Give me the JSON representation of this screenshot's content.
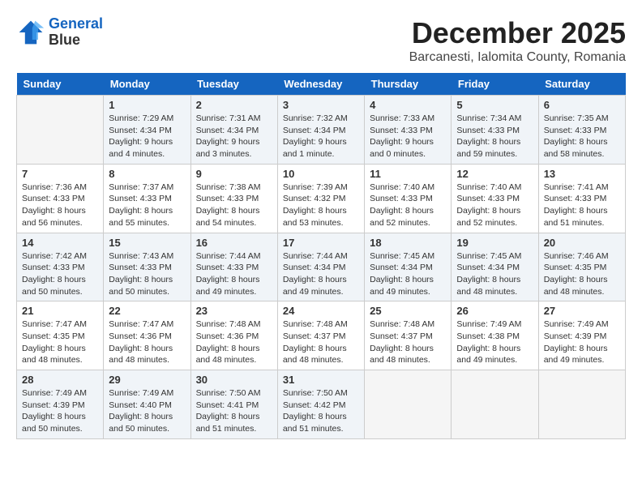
{
  "header": {
    "logo_line1": "General",
    "logo_line2": "Blue",
    "month": "December 2025",
    "location": "Barcanesti, Ialomita County, Romania"
  },
  "days_of_week": [
    "Sunday",
    "Monday",
    "Tuesday",
    "Wednesday",
    "Thursday",
    "Friday",
    "Saturday"
  ],
  "weeks": [
    [
      {
        "num": "",
        "info": ""
      },
      {
        "num": "1",
        "info": "Sunrise: 7:29 AM\nSunset: 4:34 PM\nDaylight: 9 hours\nand 4 minutes."
      },
      {
        "num": "2",
        "info": "Sunrise: 7:31 AM\nSunset: 4:34 PM\nDaylight: 9 hours\nand 3 minutes."
      },
      {
        "num": "3",
        "info": "Sunrise: 7:32 AM\nSunset: 4:34 PM\nDaylight: 9 hours\nand 1 minute."
      },
      {
        "num": "4",
        "info": "Sunrise: 7:33 AM\nSunset: 4:33 PM\nDaylight: 9 hours\nand 0 minutes."
      },
      {
        "num": "5",
        "info": "Sunrise: 7:34 AM\nSunset: 4:33 PM\nDaylight: 8 hours\nand 59 minutes."
      },
      {
        "num": "6",
        "info": "Sunrise: 7:35 AM\nSunset: 4:33 PM\nDaylight: 8 hours\nand 58 minutes."
      }
    ],
    [
      {
        "num": "7",
        "info": "Sunrise: 7:36 AM\nSunset: 4:33 PM\nDaylight: 8 hours\nand 56 minutes."
      },
      {
        "num": "8",
        "info": "Sunrise: 7:37 AM\nSunset: 4:33 PM\nDaylight: 8 hours\nand 55 minutes."
      },
      {
        "num": "9",
        "info": "Sunrise: 7:38 AM\nSunset: 4:33 PM\nDaylight: 8 hours\nand 54 minutes."
      },
      {
        "num": "10",
        "info": "Sunrise: 7:39 AM\nSunset: 4:32 PM\nDaylight: 8 hours\nand 53 minutes."
      },
      {
        "num": "11",
        "info": "Sunrise: 7:40 AM\nSunset: 4:33 PM\nDaylight: 8 hours\nand 52 minutes."
      },
      {
        "num": "12",
        "info": "Sunrise: 7:40 AM\nSunset: 4:33 PM\nDaylight: 8 hours\nand 52 minutes."
      },
      {
        "num": "13",
        "info": "Sunrise: 7:41 AM\nSunset: 4:33 PM\nDaylight: 8 hours\nand 51 minutes."
      }
    ],
    [
      {
        "num": "14",
        "info": "Sunrise: 7:42 AM\nSunset: 4:33 PM\nDaylight: 8 hours\nand 50 minutes."
      },
      {
        "num": "15",
        "info": "Sunrise: 7:43 AM\nSunset: 4:33 PM\nDaylight: 8 hours\nand 50 minutes."
      },
      {
        "num": "16",
        "info": "Sunrise: 7:44 AM\nSunset: 4:33 PM\nDaylight: 8 hours\nand 49 minutes."
      },
      {
        "num": "17",
        "info": "Sunrise: 7:44 AM\nSunset: 4:34 PM\nDaylight: 8 hours\nand 49 minutes."
      },
      {
        "num": "18",
        "info": "Sunrise: 7:45 AM\nSunset: 4:34 PM\nDaylight: 8 hours\nand 49 minutes."
      },
      {
        "num": "19",
        "info": "Sunrise: 7:45 AM\nSunset: 4:34 PM\nDaylight: 8 hours\nand 48 minutes."
      },
      {
        "num": "20",
        "info": "Sunrise: 7:46 AM\nSunset: 4:35 PM\nDaylight: 8 hours\nand 48 minutes."
      }
    ],
    [
      {
        "num": "21",
        "info": "Sunrise: 7:47 AM\nSunset: 4:35 PM\nDaylight: 8 hours\nand 48 minutes."
      },
      {
        "num": "22",
        "info": "Sunrise: 7:47 AM\nSunset: 4:36 PM\nDaylight: 8 hours\nand 48 minutes."
      },
      {
        "num": "23",
        "info": "Sunrise: 7:48 AM\nSunset: 4:36 PM\nDaylight: 8 hours\nand 48 minutes."
      },
      {
        "num": "24",
        "info": "Sunrise: 7:48 AM\nSunset: 4:37 PM\nDaylight: 8 hours\nand 48 minutes."
      },
      {
        "num": "25",
        "info": "Sunrise: 7:48 AM\nSunset: 4:37 PM\nDaylight: 8 hours\nand 48 minutes."
      },
      {
        "num": "26",
        "info": "Sunrise: 7:49 AM\nSunset: 4:38 PM\nDaylight: 8 hours\nand 49 minutes."
      },
      {
        "num": "27",
        "info": "Sunrise: 7:49 AM\nSunset: 4:39 PM\nDaylight: 8 hours\nand 49 minutes."
      }
    ],
    [
      {
        "num": "28",
        "info": "Sunrise: 7:49 AM\nSunset: 4:39 PM\nDaylight: 8 hours\nand 50 minutes."
      },
      {
        "num": "29",
        "info": "Sunrise: 7:49 AM\nSunset: 4:40 PM\nDaylight: 8 hours\nand 50 minutes."
      },
      {
        "num": "30",
        "info": "Sunrise: 7:50 AM\nSunset: 4:41 PM\nDaylight: 8 hours\nand 51 minutes."
      },
      {
        "num": "31",
        "info": "Sunrise: 7:50 AM\nSunset: 4:42 PM\nDaylight: 8 hours\nand 51 minutes."
      },
      {
        "num": "",
        "info": ""
      },
      {
        "num": "",
        "info": ""
      },
      {
        "num": "",
        "info": ""
      }
    ]
  ]
}
